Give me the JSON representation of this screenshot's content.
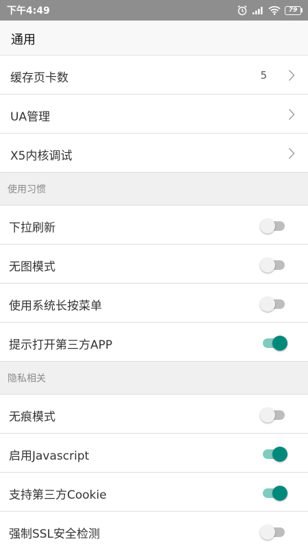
{
  "status_bar": {
    "time": "下午4:49",
    "battery": "79"
  },
  "header": {
    "title": "通用"
  },
  "nav_items": [
    {
      "label": "缓存页卡数",
      "value": "5"
    },
    {
      "label": "UA管理",
      "value": ""
    },
    {
      "label": "X5内核调试",
      "value": ""
    }
  ],
  "sections": [
    {
      "title": "使用习惯",
      "items": [
        {
          "label": "下拉刷新",
          "enabled": false
        },
        {
          "label": "无图模式",
          "enabled": false
        },
        {
          "label": "使用系统长按菜单",
          "enabled": false
        },
        {
          "label": "提示打开第三方APP",
          "enabled": true
        }
      ]
    },
    {
      "title": "隐私相关",
      "items": [
        {
          "label": "无痕模式",
          "enabled": false
        },
        {
          "label": "启用Javascript",
          "enabled": true
        },
        {
          "label": "支持第三方Cookie",
          "enabled": true
        },
        {
          "label": "强制SSL安全检测",
          "enabled": false
        }
      ]
    }
  ],
  "colors": {
    "accent": "#00897b",
    "accent_track": "#80cbbf",
    "status_bar": "#8e8e8e"
  }
}
